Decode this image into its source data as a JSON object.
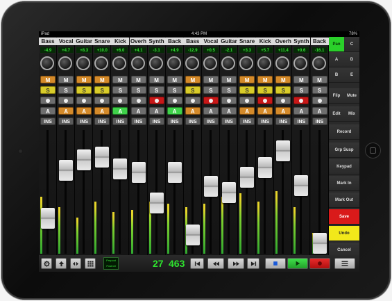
{
  "status_bar": {
    "carrier": "iPad",
    "time": "4:43 PM",
    "battery": "78%"
  },
  "channels": [
    {
      "name": "Bass",
      "value": "-4.9",
      "mute": true,
      "solo": true,
      "rec": false,
      "auto": "A",
      "auto_state": "off",
      "ins": "INS"
    },
    {
      "name": "Vocal",
      "value": "+4.7",
      "mute": false,
      "solo": false,
      "rec": false,
      "auto": "A",
      "auto_state": "on",
      "ins": "INS"
    },
    {
      "name": "Guitar",
      "value": "+8.3",
      "mute": true,
      "solo": true,
      "rec": false,
      "auto": "A",
      "auto_state": "on",
      "ins": "INS"
    },
    {
      "name": "Snare",
      "value": "+10.0",
      "mute": true,
      "solo": true,
      "rec": false,
      "auto": "A",
      "auto_state": "on",
      "ins": "INS"
    },
    {
      "name": "Kick",
      "value": "+6.0",
      "mute": false,
      "solo": false,
      "rec": false,
      "auto": "A",
      "auto_state": "green",
      "ins": "INS"
    },
    {
      "name": "Overh",
      "value": "+4.1",
      "mute": false,
      "solo": false,
      "rec": false,
      "auto": "A",
      "auto_state": "off",
      "ins": "INS"
    },
    {
      "name": "Synth",
      "value": "-3.1",
      "mute": false,
      "solo": false,
      "rec": true,
      "auto": "A",
      "auto_state": "off",
      "ins": "INS"
    },
    {
      "name": "Back",
      "value": "+4.9",
      "mute": false,
      "solo": false,
      "rec": false,
      "auto": "A",
      "auto_state": "green",
      "ins": "INS"
    },
    {
      "name": "Bass",
      "value": "-12.9",
      "mute": true,
      "solo": true,
      "rec": false,
      "auto": "A",
      "auto_state": "on",
      "ins": "INS"
    },
    {
      "name": "Vocal",
      "value": "+0.5",
      "mute": false,
      "solo": false,
      "rec": true,
      "auto": "A",
      "auto_state": "off",
      "ins": "INS"
    },
    {
      "name": "Guitar",
      "value": "-2.1",
      "mute": false,
      "solo": false,
      "rec": false,
      "auto": "A",
      "auto_state": "off",
      "ins": "INS"
    },
    {
      "name": "Snare",
      "value": "+3.3",
      "mute": true,
      "solo": true,
      "rec": false,
      "auto": "A",
      "auto_state": "on",
      "ins": "INS"
    },
    {
      "name": "Kick",
      "value": "+5.7",
      "mute": true,
      "solo": true,
      "rec": true,
      "auto": "A",
      "auto_state": "on",
      "ins": "INS"
    },
    {
      "name": "Overh",
      "value": "+11.4",
      "mute": true,
      "solo": true,
      "rec": false,
      "auto": "A",
      "auto_state": "on",
      "ins": "INS"
    },
    {
      "name": "Synth",
      "value": "+0.6",
      "mute": false,
      "solo": false,
      "rec": true,
      "auto": "A",
      "auto_state": "off",
      "ins": "INS"
    },
    {
      "name": "Back",
      "value": "-16.1",
      "mute": false,
      "solo": false,
      "rec": false,
      "auto": "A",
      "auto_state": "off",
      "ins": "INS"
    }
  ],
  "fader_levels": [
    0.25,
    0.72,
    0.82,
    0.85,
    0.73,
    0.7,
    0.4,
    0.7,
    0.08,
    0.56,
    0.5,
    0.65,
    0.75,
    0.91,
    0.57,
    0.0
  ],
  "meter_levels": [
    0.55,
    0.45,
    0.35,
    0.5,
    0.4,
    0.42,
    0.5,
    0.48,
    0.45,
    0.48,
    0.55,
    0.58,
    0.5,
    0.6,
    0.45,
    0.2
  ],
  "button_labels": {
    "mute": "M",
    "solo": "S"
  },
  "right_panel": {
    "pan": "Pan",
    "c": "C",
    "a": "A",
    "d": "D",
    "b": "B",
    "e": "E",
    "flip": "Flip",
    "mute": "Mute",
    "edit": "Edit",
    "mix": "Mix",
    "record": "Record",
    "grp_susp": "Grp Susp",
    "keypad": "Keypad",
    "mark_in": "Mark In",
    "mark_out": "Mark Out",
    "save": "Save",
    "undo": "Undo",
    "cancel": "Cancel"
  },
  "toolbar": {
    "locator_top": "Prepost",
    "locator_bottom": "Postroll",
    "counter_bars": "27",
    "counter_beats": "463",
    "icons": [
      "gear-icon",
      "arrow-up-icon",
      "arrows-left-right-icon",
      "grid-icon",
      "rewind-to-start-icon",
      "rewind-icon",
      "fast-forward-icon",
      "forward-to-end-icon",
      "stop-icon",
      "play-icon",
      "record-icon",
      "menu-icon"
    ]
  },
  "colors": {
    "accent_green": "#2ee32e",
    "mute_orange": "#d48a2a",
    "solo_yellow": "#d8cc2a",
    "record_red": "#c81818",
    "save_red": "#d91a1a",
    "undo_yellow": "#f2e81a"
  }
}
